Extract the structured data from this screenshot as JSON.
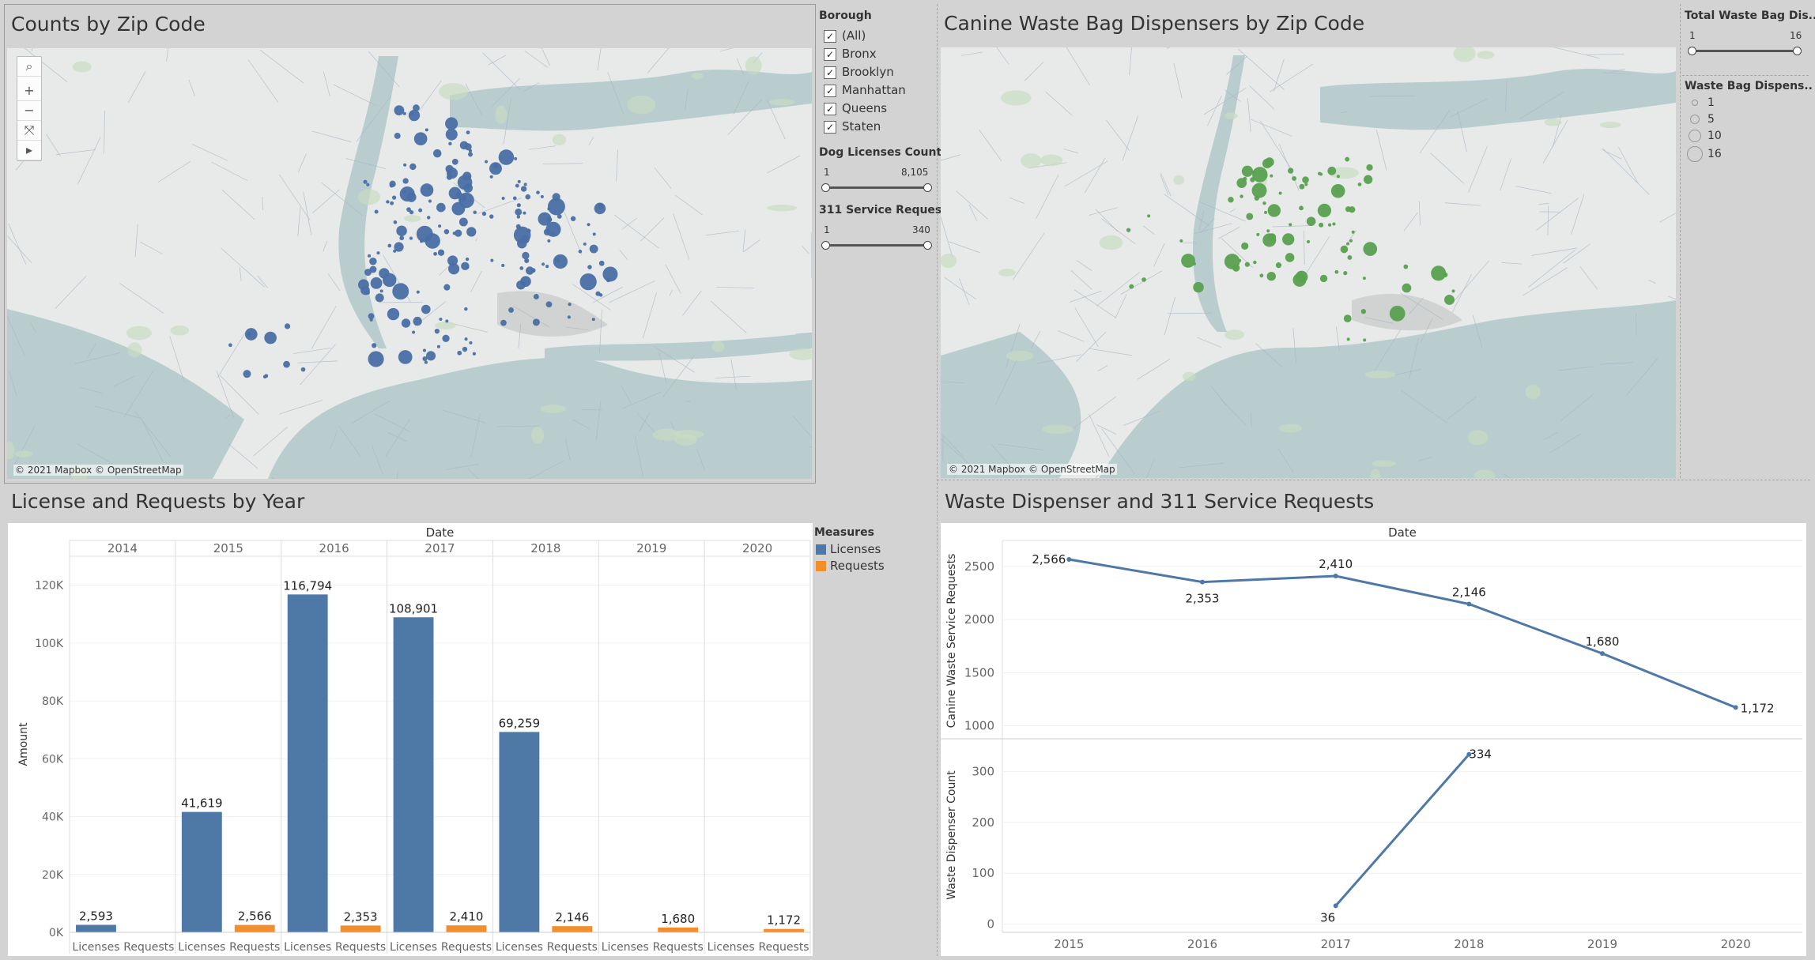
{
  "panels": {
    "counts_map": {
      "title": "Counts by Zip Code",
      "attribution": "© 2021 Mapbox © OpenStreetMap"
    },
    "dispenser_map": {
      "title": "Canine Waste Bag Dispensers by Zip Code",
      "attribution": "© 2021 Mapbox © OpenStreetMap"
    },
    "license_chart": {
      "title": "License and Requests by Year"
    },
    "waste_chart": {
      "title": "Waste Dispenser and 311 Service Requests"
    }
  },
  "map_controls": [
    "search-icon",
    "zoom-in-icon",
    "zoom-out-icon",
    "clear-selection-icon",
    "expand-icon"
  ],
  "map_control_glyphs": [
    "⌕",
    "+",
    "−",
    "⤧",
    "▸"
  ],
  "filters": {
    "borough": {
      "title": "Borough",
      "items": [
        {
          "label": "(All)",
          "checked": true
        },
        {
          "label": "Bronx",
          "checked": true
        },
        {
          "label": "Brooklyn",
          "checked": true
        },
        {
          "label": "Manhattan",
          "checked": true
        },
        {
          "label": "Queens",
          "checked": true
        },
        {
          "label": "Staten",
          "checked": true
        }
      ]
    },
    "dog_licenses": {
      "title": "Dog Licenses Count",
      "min": "1",
      "max": "8,105"
    },
    "service_requests": {
      "title": "311 Service Reques..",
      "min": "1",
      "max": "340"
    },
    "total_waste": {
      "title": "Total Waste Bag Dis..",
      "min": "1",
      "max": "16"
    },
    "waste_size_legend": {
      "title": "Waste Bag Dispens..",
      "items": [
        "1",
        "5",
        "10",
        "16"
      ]
    }
  },
  "measures_legend": {
    "title": "Measures",
    "items": [
      {
        "label": "Licenses",
        "color": "#4e79a7"
      },
      {
        "label": "Requests",
        "color": "#f28e2b"
      }
    ]
  },
  "colors": {
    "licenses": "#4e79a7",
    "requests": "#f28e2b",
    "line": "#4e79a7",
    "green_dot": "#59a14f",
    "blue_dot": "#4a6fa5"
  },
  "chart_data": [
    {
      "type": "bar",
      "title": "License and Requests by Year",
      "column_header": "Date",
      "categories": [
        "2014",
        "2015",
        "2016",
        "2017",
        "2018",
        "2019",
        "2020"
      ],
      "sub_categories": [
        "Licenses",
        "Requests"
      ],
      "ylabel": "Amount",
      "ylim": [
        0,
        130000
      ],
      "yticks": [
        "0K",
        "20K",
        "40K",
        "60K",
        "80K",
        "100K",
        "120K"
      ],
      "series": [
        {
          "name": "Licenses",
          "values": [
            2593,
            41619,
            116794,
            108901,
            69259,
            null,
            null
          ],
          "labels": [
            "2,593",
            "41,619",
            "116,794",
            "108,901",
            "69,259",
            "",
            ""
          ]
        },
        {
          "name": "Requests",
          "values": [
            null,
            2566,
            2353,
            2410,
            2146,
            1680,
            1172
          ],
          "labels": [
            "",
            "2,566",
            "2,353",
            "2,410",
            "2,146",
            "1,680",
            "1,172"
          ]
        }
      ]
    },
    {
      "type": "line",
      "title": "Waste Dispenser and 311 Service Requests",
      "column_header": "Date",
      "x": [
        "2015",
        "2016",
        "2017",
        "2018",
        "2019",
        "2020"
      ],
      "panes": [
        {
          "ylabel": "Canine Waste Service Requests",
          "ylim": [
            900,
            2700
          ],
          "yticks": [
            "1000",
            "1500",
            "2000",
            "2500"
          ],
          "values": [
            2566,
            2353,
            2410,
            2146,
            1680,
            1172
          ],
          "labels": [
            "2,566",
            "2,353",
            "2,410",
            "2,146",
            "1,680",
            "1,172"
          ]
        },
        {
          "ylabel": "Waste Dispenser Count",
          "ylim": [
            -10,
            360
          ],
          "yticks": [
            "0",
            "100",
            "200",
            "300"
          ],
          "values": [
            null,
            null,
            36,
            334,
            null,
            null
          ],
          "labels": [
            "",
            "",
            "36",
            "334",
            "",
            ""
          ]
        }
      ]
    }
  ]
}
